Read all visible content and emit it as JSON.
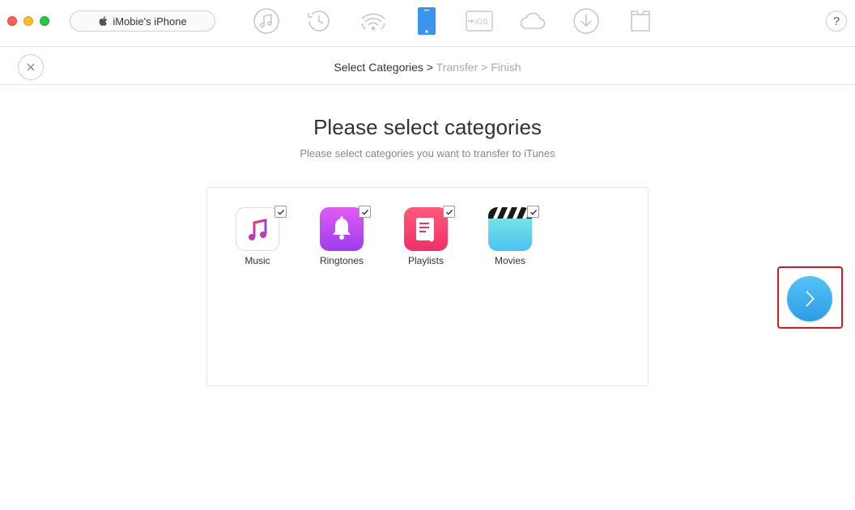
{
  "titlebar": {
    "device_name": "iMobie's iPhone",
    "toolbar_icons": [
      "music-note-icon",
      "history-clock-icon",
      "wifi-sync-icon",
      "iphone-device-icon",
      "to-ios-icon",
      "cloud-icon",
      "download-icon",
      "tshirt-icon"
    ],
    "active_icon": "iphone-device-icon",
    "help_label": "?"
  },
  "steps": {
    "current": "Select Categories",
    "sep1": ">",
    "step2": "Transfer",
    "sep2": ">",
    "step3": "Finish"
  },
  "main": {
    "title": "Please select categories",
    "subtitle": "Please select categories you want to transfer to iTunes"
  },
  "categories": [
    {
      "label": "Music",
      "checked": true,
      "icon": "music-app-icon"
    },
    {
      "label": "Ringtones",
      "checked": true,
      "icon": "bell-icon"
    },
    {
      "label": "Playlists",
      "checked": true,
      "icon": "playlist-icon"
    },
    {
      "label": "Movies",
      "checked": true,
      "icon": "clapperboard-icon"
    }
  ],
  "colors": {
    "accent": "#2d9ce7",
    "highlight_border": "#e0161c",
    "active_toolbar": "#3a95f0",
    "inactive_toolbar": "#c8c8c8"
  }
}
